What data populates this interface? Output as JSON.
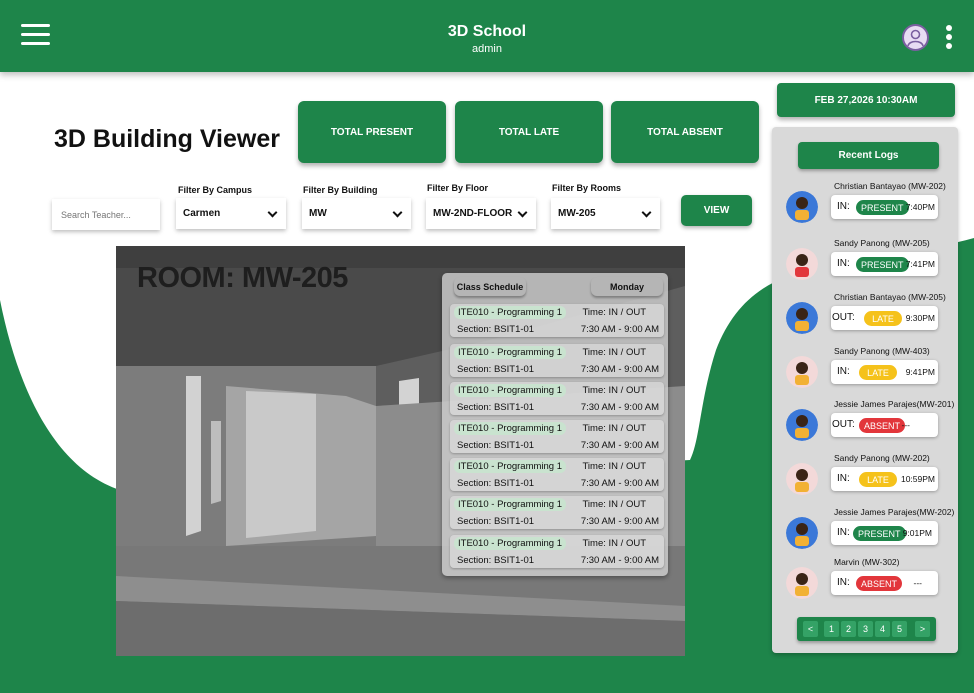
{
  "header": {
    "title": "3D School",
    "subtitle": "admin"
  },
  "page_title": "3D Building Viewer",
  "stats": {
    "present": "TOTAL PRESENT",
    "late": "TOTAL LATE",
    "absent": "TOTAL ABSENT"
  },
  "search": {
    "placeholder": "Search Teacher..."
  },
  "filters": [
    {
      "label": "Filter By Campus",
      "value": "Carmen"
    },
    {
      "label": "Filter By Building",
      "value": "MW"
    },
    {
      "label": "Filter By Floor",
      "value": "MW-2ND-FLOOR"
    },
    {
      "label": "Filter By Rooms",
      "value": "MW-205"
    }
  ],
  "view_button": "VIEW",
  "viewer": {
    "room_label": "ROOM: MW-205",
    "schedule_tab": "Class Schedule",
    "day": "Monday",
    "rows": [
      {
        "course": "ITE010 - Programming 1",
        "time": "Time: IN / OUT",
        "section": "Section: BSIT1-01",
        "hours": "7:30 AM - 9:00 AM"
      },
      {
        "course": "ITE010 - Programming 1",
        "time": "Time: IN / OUT",
        "section": "Section: BSIT1-01",
        "hours": "7:30 AM - 9:00 AM"
      },
      {
        "course": "ITE010 - Programming 1",
        "time": "Time: IN / OUT",
        "section": "Section: BSIT1-01",
        "hours": "7:30 AM - 9:00 AM"
      },
      {
        "course": "ITE010 - Programming 1",
        "time": "Time: IN / OUT",
        "section": "Section: BSIT1-01",
        "hours": "7:30 AM - 9:00 AM"
      },
      {
        "course": "ITE010 - Programming 1",
        "time": "Time: IN / OUT",
        "section": "Section: BSIT1-01",
        "hours": "7:30 AM - 9:00 AM"
      },
      {
        "course": "ITE010 - Programming 1",
        "time": "Time: IN / OUT",
        "section": "Section: BSIT1-01",
        "hours": "7:30 AM - 9:00 AM"
      },
      {
        "course": "ITE010 - Programming 1",
        "time": "Time: IN / OUT",
        "section": "Section: BSIT1-01",
        "hours": "7:30 AM - 9:00 AM"
      }
    ]
  },
  "datetime": "FEB 27,2026 10:30AM",
  "logs": {
    "title": "Recent Logs",
    "items": [
      {
        "name": "Christian Bantayao (MW-202)",
        "dir": "IN:",
        "status": "PRESENT",
        "time": "7:40PM"
      },
      {
        "name": "Sandy Panong (MW-205)",
        "dir": "IN:",
        "status": "PRESENT",
        "time": "7:41PM"
      },
      {
        "name": "Christian Bantayao (MW-205)",
        "dir": "OUT:",
        "status": "LATE",
        "time": "9:30PM"
      },
      {
        "name": "Sandy Panong (MW-403)",
        "dir": "IN:",
        "status": "LATE",
        "time": "9:41PM"
      },
      {
        "name": "Jessie James Parajes(MW-201)",
        "dir": "OUT:",
        "status": "ABSENT",
        "time": "---"
      },
      {
        "name": "Sandy Panong  (MW-202)",
        "dir": "IN:",
        "status": "LATE",
        "time": "10:59PM"
      },
      {
        "name": "Jessie James Parajes(MW-202)",
        "dir": "IN:",
        "status": "PRESENT",
        "time": "9:01PM"
      },
      {
        "name": "Marvin (MW-302)",
        "dir": "IN:",
        "status": "ABSENT",
        "time": "---"
      }
    ]
  },
  "pager": {
    "prev": "<",
    "pages": [
      "1",
      "2",
      "3",
      "4",
      "5"
    ],
    "next": ">"
  },
  "colors": {
    "brand": "#1e854a",
    "present": "#1e854a",
    "late": "#f5c21b",
    "absent": "#e2363b"
  }
}
